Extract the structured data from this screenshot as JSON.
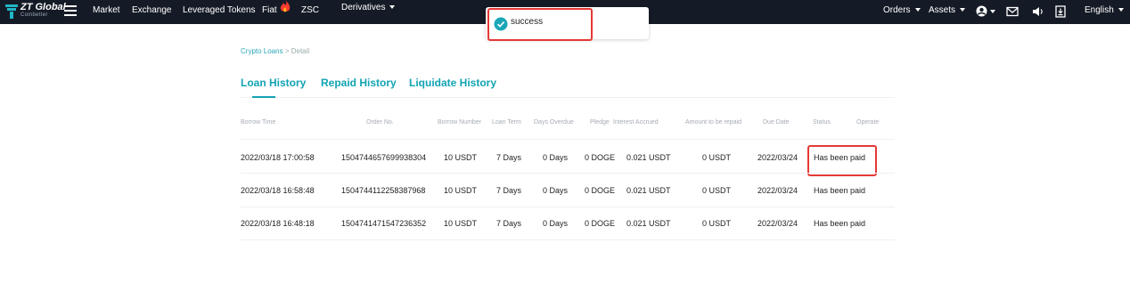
{
  "nav": {
    "logo_title": "ZT Global",
    "logo_subtitle": "Coinbetter",
    "items": {
      "market": "Market",
      "exchange": "Exchange",
      "leveraged": "Leveraged Tokens",
      "fiat": "Fiat",
      "zsc": "ZSC",
      "derivatives": "Derivatives"
    },
    "right": {
      "orders": "Orders",
      "assets": "Assets",
      "language": "English"
    },
    "icons": [
      "menu-icon",
      "flame-icon",
      "account-icon",
      "mail-icon",
      "speaker-icon",
      "download-icon"
    ]
  },
  "toast": {
    "message": "success",
    "icon": "check-circle-icon",
    "color": "#1aa6b7"
  },
  "breadcrumb": {
    "parent": "Crypto Loans",
    "separator": ">",
    "current": "Detail"
  },
  "tabs": [
    {
      "label": "Loan History",
      "active": true
    },
    {
      "label": "Repaid History",
      "active": false
    },
    {
      "label": "Liquidate History",
      "active": false
    }
  ],
  "table": {
    "columns": [
      "Borrow Time",
      "Order No.",
      "Borrow Number",
      "Loan Term",
      "Days Overdue",
      "Pledge",
      "Interest Accrued",
      "Amount to be repaid",
      "Due Date",
      "Status",
      "Operate"
    ],
    "rows": [
      [
        "2022/03/18 17:00:58",
        "1504744657699938304",
        "10 USDT",
        "7 Days",
        "0 Days",
        "0 DOGE",
        "0.021 USDT",
        "0 USDT",
        "2022/03/24",
        "Has been paid"
      ],
      [
        "2022/03/18 16:58:48",
        "1504744112258387968",
        "10 USDT",
        "7 Days",
        "0 Days",
        "0 DOGE",
        "0.021 USDT",
        "0 USDT",
        "2022/03/24",
        "Has been paid"
      ],
      [
        "2022/03/18 16:48:18",
        "1504741471547236352",
        "10 USDT",
        "7 Days",
        "0 Days",
        "0 DOGE",
        "0.021 USDT",
        "0 USDT",
        "2022/03/24",
        "Has been paid"
      ]
    ]
  },
  "colors": {
    "accent": "#12a3b3",
    "nav_bg": "#151b26",
    "highlight": "#e53935"
  }
}
